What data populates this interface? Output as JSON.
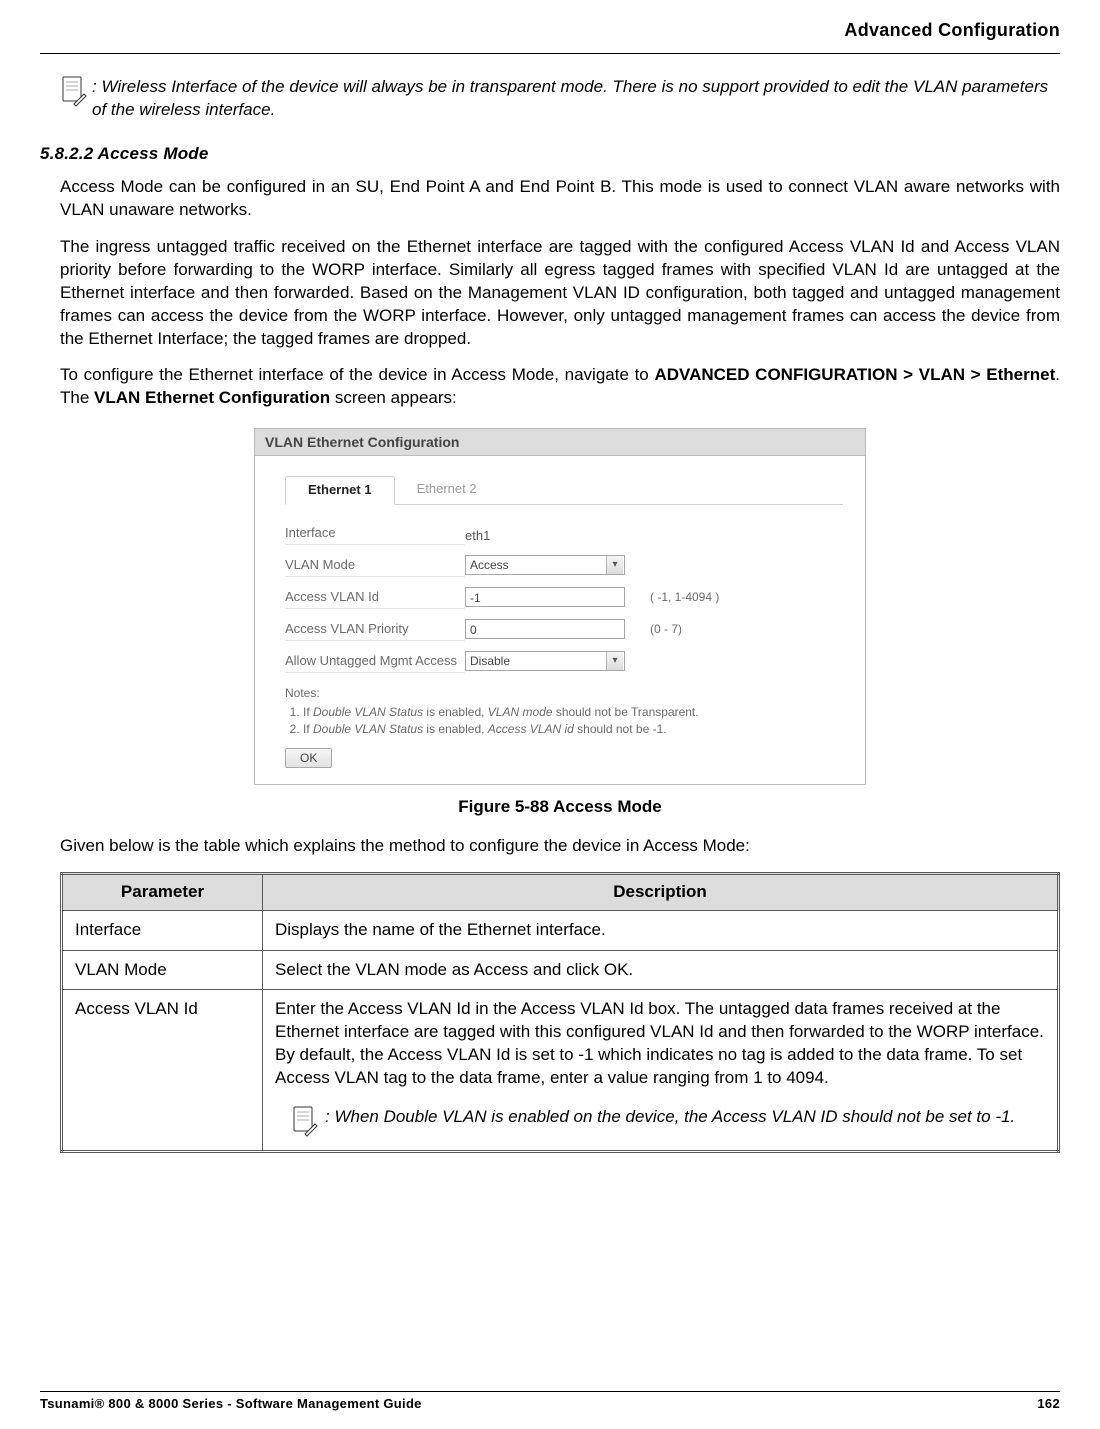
{
  "header": {
    "title": "Advanced Configuration"
  },
  "note_top": {
    "text": ": Wireless Interface of the device will always be in transparent mode. There is no support provided to edit the VLAN parameters of the wireless interface."
  },
  "section": {
    "heading": "5.8.2.2 Access Mode"
  },
  "para1": "Access Mode can be configured in an SU, End Point A and End Point B. This mode is used to connect VLAN aware networks with VLAN unaware networks.",
  "para2": "The ingress untagged traffic received on the Ethernet interface are tagged with the configured Access VLAN Id and Access VLAN priority before forwarding to the WORP interface. Similarly all egress tagged frames with specified VLAN Id are untagged at the Ethernet interface and then forwarded. Based on the Management VLAN ID configuration, both tagged and untagged management frames can access the device from the WORP interface. However, only untagged management frames can access the device from the Ethernet Interface; the tagged frames are dropped.",
  "para3_a": "To configure the Ethernet interface of the device in Access Mode, navigate to ",
  "para3_b_bold": "ADVANCED CONFIGURATION > VLAN > Ethernet",
  "para3_c": ". The ",
  "para3_d_bold": "VLAN Ethernet Configuration",
  "para3_e": " screen appears:",
  "panel": {
    "title": "VLAN Ethernet Configuration",
    "tabs": {
      "active": "Ethernet 1",
      "inactive": "Ethernet 2"
    },
    "rows": {
      "r1": {
        "label": "Interface",
        "value": "eth1"
      },
      "r2": {
        "label": "VLAN Mode",
        "value": "Access"
      },
      "r3": {
        "label": "Access VLAN Id",
        "value": "-1",
        "hint": "( -1, 1-4094 )"
      },
      "r4": {
        "label": "Access VLAN Priority",
        "value": "0",
        "hint": "(0 - 7)"
      },
      "r5": {
        "label": "Allow Untagged Mgmt Access",
        "value": "Disable"
      }
    },
    "notes": {
      "heading": "Notes:",
      "n1a": "If ",
      "n1b_i": "Double VLAN Status",
      "n1c": " is enabled, ",
      "n1d_i": "VLAN mode",
      "n1e": " should not be Transparent.",
      "n2a": "If ",
      "n2b_i": "Double VLAN Status",
      "n2c": " is enabled, ",
      "n2d_i": "Access VLAN id",
      "n2e": " should not be -1."
    },
    "ok": "OK"
  },
  "figure_caption": "Figure 5-88 Access Mode",
  "para4": "Given below is the table which explains the method to configure the device in Access Mode:",
  "table": {
    "h1": "Parameter",
    "h2": "Description",
    "r1": {
      "p": "Interface",
      "d": "Displays the name of the Ethernet interface."
    },
    "r2": {
      "p": "VLAN Mode",
      "d_a": "Select the ",
      "d_b_bold": "VLAN mode",
      "d_c": " as ",
      "d_d_bold": "Access",
      "d_e": " and click ",
      "d_f_bold": "OK",
      "d_g": "."
    },
    "r3": {
      "p": "Access VLAN Id",
      "d_a": "Enter the Access VLAN Id in the ",
      "d_b_bold": "Access VLAN Id",
      "d_c": " box. The untagged data frames received at the Ethernet interface are tagged with this configured VLAN Id and then forwarded to the WORP interface. By default, the Access VLAN Id is set to -1 which indicates no tag is added to the data frame. To set Access VLAN tag to the data frame, enter a value ranging from 1 to 4094.",
      "note": ": When Double VLAN is enabled on the device, the Access VLAN ID should not be set to -1."
    }
  },
  "footer": {
    "left": "Tsunami® 800 & 8000 Series - Software Management Guide",
    "right": "162"
  }
}
